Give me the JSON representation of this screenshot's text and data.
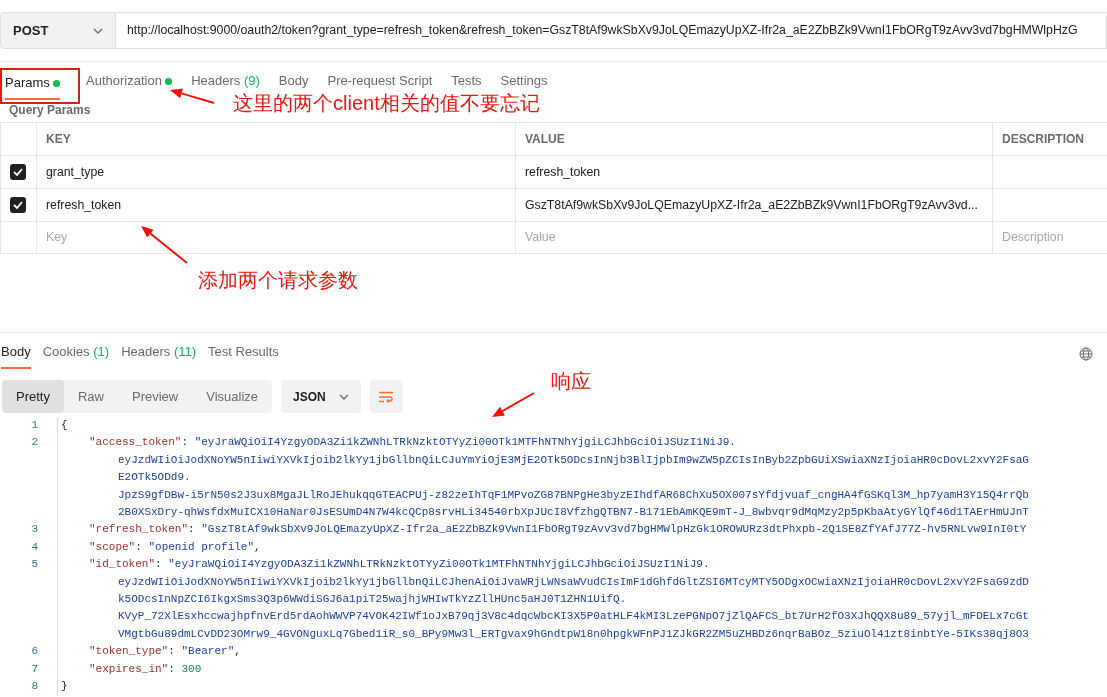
{
  "request": {
    "method": "POST",
    "url": "http://localhost:9000/oauth2/token?grant_type=refresh_token&refresh_token=GszT8tAf9wkSbXv9JoLQEmazyUpXZ-Ifr2a_aE2ZbBZk9VwnI1FbORgT9zAvv3vd7bgHMWlpHzG"
  },
  "request_tabs": [
    {
      "label": "Params",
      "dot": true,
      "selected": true,
      "annotated": true
    },
    {
      "label": "Authorization",
      "dot": true,
      "selected": false,
      "annotated": false
    },
    {
      "label": "Headers",
      "count": "(9)",
      "dot": false,
      "selected": false,
      "annotated": false
    },
    {
      "label": "Body",
      "dot": false,
      "selected": false,
      "annotated": false
    },
    {
      "label": "Pre-request Script",
      "dot": false,
      "selected": false,
      "annotated": false
    },
    {
      "label": "Tests",
      "dot": false,
      "selected": false,
      "annotated": false
    },
    {
      "label": "Settings",
      "dot": false,
      "selected": false,
      "annotated": false
    }
  ],
  "params": {
    "title": "Query Params",
    "columns": [
      "KEY",
      "VALUE",
      "DESCRIPTION"
    ],
    "rows": [
      {
        "checked": true,
        "key": "grant_type",
        "value": "refresh_token"
      },
      {
        "checked": true,
        "key": "refresh_token",
        "value": "GszT8tAf9wkSbXv9JoLQEmazyUpXZ-Ifr2a_aE2ZbBZk9VwnI1FbORgT9zAvv3vd..."
      }
    ],
    "placeholders": [
      "Key",
      "Value",
      "Description"
    ]
  },
  "response_tabs": [
    {
      "label": "Body",
      "selected": true
    },
    {
      "label": "Cookies",
      "count": "(1)",
      "selected": false
    },
    {
      "label": "Headers",
      "count": "(11)",
      "selected": false
    },
    {
      "label": "Test Results",
      "selected": false
    }
  ],
  "view_modes": [
    {
      "label": "Pretty",
      "selected": true
    },
    {
      "label": "Raw",
      "selected": false
    },
    {
      "label": "Preview",
      "selected": false
    },
    {
      "label": "Visualize",
      "selected": false
    }
  ],
  "format": "JSON",
  "code_lines": [
    {
      "number": "1",
      "kind": "brace",
      "text": "{"
    },
    {
      "number": "2",
      "kind": "string_pair",
      "key": "\"access_token\"",
      "separator": ":",
      "value": "\"eyJraWQiOiI4YzgyODA3Zi1kZWNhLTRkNzktOTYyZi00OTk1MTFhNTNhYjgiLCJhbGciOiJSUzI1NiJ9.",
      "continuation": [
        "eyJzdWIiOiJodXNoYW5nIiwiYXVkIjoib2lkYy1jbGllbnQiLCJuYmYiOjE3MjE2OTk5ODcsInNjb3BlIjpbIm9wZW5pZCIsInByb2ZpbGUiXSwiaXNzIjoiaHR0cDovL2xvY2FsaG",
        "E2OTk5ODd9.",
        "JpzS9gfDBw-i5rN50s2J3ux8MgaJLlRoJEhukqqGTEACPUj-z82zeIhTqF1MPvoZG87BNPgHe3byzEIhdfAR68ChXu5OX007sYfdjvuaf_cngHA4fGSKql3M_hp7yamH3Y15Q4rrQb",
        "2B0XSxDry-qhWsfdxMuICX10HaNar0JsESUmD4N7W4kcQCp8srvHLi34540rbXpJUcI8VfzhgQTBN7-B171EbAmKQE9mT-J_8wbvqr9dMqMzy2p5pKbaAtyGYlQf46d1TAErHmUJnT"
      ]
    },
    {
      "number": "3",
      "kind": "string_pair",
      "key": "\"refresh_token\"",
      "separator": ":",
      "value": "\"GszT8tAf9wkSbXv9JoLQEmazyUpXZ-Ifr2a_aE2ZbBZk9VwnI1FbORgT9zAvv3vd7bgHMWlpHzGk1OROWURz3dtPhxpb-2Q1SE8ZfYAfJ77Z-hv5RNLvw9InI0tY"
    },
    {
      "number": "4",
      "kind": "string_pair",
      "key": "\"scope\"",
      "separator": ":",
      "value": "\"openid profile\"",
      "trail": ","
    },
    {
      "number": "5",
      "kind": "string_pair",
      "key": "\"id_token\"",
      "separator": ":",
      "value": "\"eyJraWQiOiI4YzgyODA3Zi1kZWNhLTRkNzktOTYyZi00OTk1MTFhNTNhYjgiLCJhbGciOiJSUzI1NiJ9.",
      "continuation": [
        "eyJzdWIiOiJodXNoYW5nIiwiYXVkIjoib2lkYy1jbGllbnQiLCJhenAiOiJvaWRjLWNsaWVudCIsImF1dGhfdGltZSI6MTcyMTY5ODgxOCwiaXNzIjoiaHR0cDovL2xvY2FsaG9zdD",
        "k5ODcsInNpZCI6IkgxSms3Q3p6WWdiSGJ6a1piT25wajhjWHIwTkYzZllHUnc5aHJ0T1ZHN1UifQ.",
        "KVyP_72XlEsxhccwajhpfnvErd5rdAohWWVP74VOK42IWf1oJxB79qj3V8c4dqcWbcKI3X5P0atHLF4kMI3LzePGNpO7jZlQAFCS_bt7UrH2fO3XJhQQX8u89_57yjl_mFDELx7cGt",
        "VMgtbGu89dmLCvDD23OMrw9_4GVONguxLq7Gbed1iR_s0_BPy9Mw3l_ERTgvax9hGndtpW18n0hpgkWFnPJ1ZJkGR2ZM5uZHBDz6nqrBaBOz_5ziuOl41zt8inbtYe-5IKs38qj8O3"
      ]
    },
    {
      "number": "6",
      "kind": "string_pair",
      "key": "\"token_type\"",
      "separator": ":",
      "value": "\"Bearer\"",
      "trail": ","
    },
    {
      "number": "7",
      "kind": "number_pair",
      "key": "\"expires_in\"",
      "separator": ":",
      "value": "300"
    },
    {
      "number": "8",
      "kind": "brace",
      "text": "}"
    }
  ],
  "annotations": [
    {
      "text": "这里的两个client相关的值不要忘记"
    },
    {
      "text": "添加两个请求参数"
    },
    {
      "text": "响应"
    }
  ]
}
